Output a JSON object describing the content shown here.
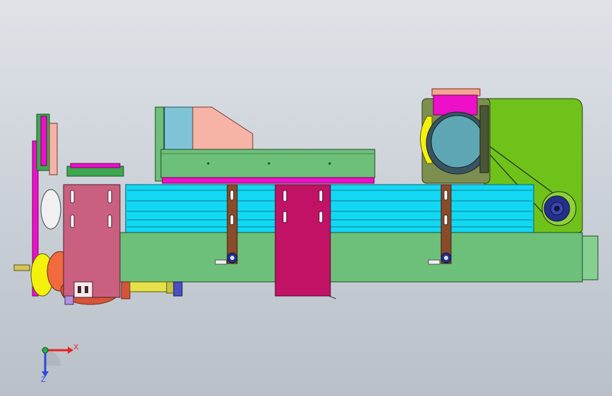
{
  "viewport": {
    "background_top": "#dfe3e8",
    "background_bottom": "#b9c0c8"
  },
  "triad": {
    "x_label": "X",
    "z_label": "Z",
    "x_color": "#e8231f",
    "z_color": "#2b4ad8",
    "origin_color": "#21b14b"
  },
  "colors": {
    "base_green": "#6dc07a",
    "cyan_rail": "#12d8f3",
    "magenta": "#ee10c9",
    "pink_plate": "#c9607f",
    "crimson_plate": "#c21266",
    "salmon": "#f6b3a6",
    "lime": "#6fc21a",
    "olive": "#7d8f4e",
    "teal_motor": "#5fa6b4",
    "yellow": "#f4f10c",
    "navy": "#25308c",
    "brown": "#8a4b2a",
    "orange": "#e36b2a"
  }
}
